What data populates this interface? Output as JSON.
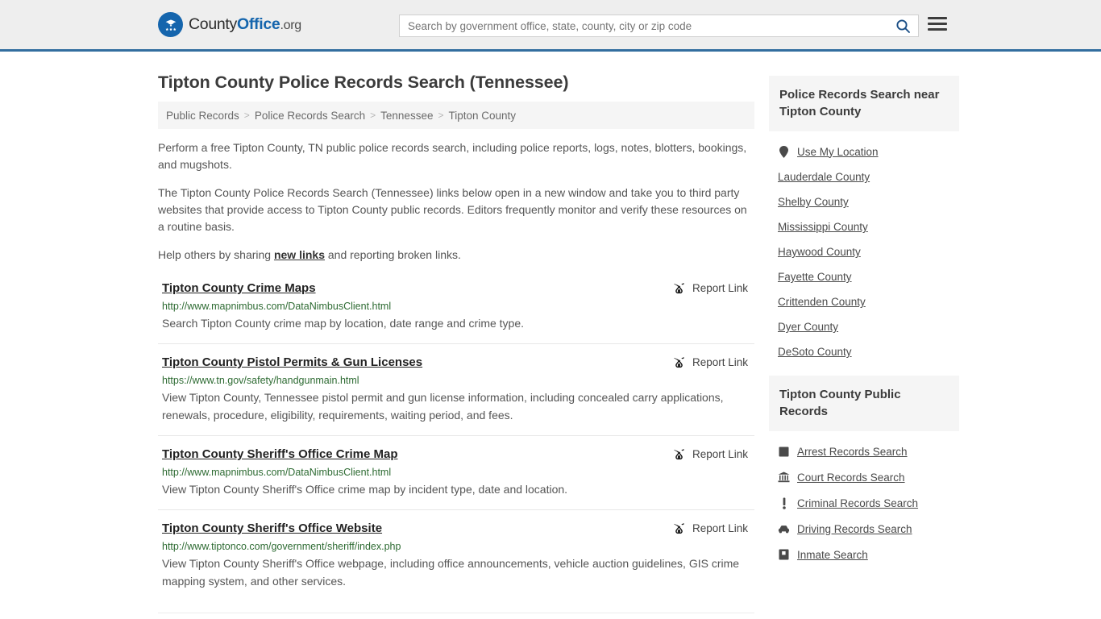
{
  "header": {
    "brand": {
      "part1": "County",
      "part2": "Office",
      "part3": ".org",
      "logo_icon": "eagle-seal-icon"
    },
    "search": {
      "placeholder": "Search by government office, state, county, city or zip code",
      "value": "",
      "icon": "search-icon"
    },
    "menu": {
      "icon": "hamburger-menu-icon",
      "label": "Menu"
    }
  },
  "main": {
    "title": "Tipton County Police Records Search (Tennessee)",
    "breadcrumb": [
      {
        "label": "Public Records"
      },
      {
        "label": "Police Records Search"
      },
      {
        "label": "Tennessee"
      },
      {
        "label": "Tipton County"
      }
    ],
    "breadcrumb_separator": ">",
    "intro": {
      "p1": "Perform a free Tipton County, TN public police records search, including police reports, logs, notes, blotters, bookings, and mugshots.",
      "p2": "The Tipton County Police Records Search (Tennessee) links below open in a new window and take you to third party websites that provide access to Tipton County public records. Editors frequently monitor and verify these resources on a routine basis.",
      "p3_before": "Help others by sharing ",
      "p3_link": "new links",
      "p3_after": " and reporting broken links."
    },
    "report_link_label": "Report Link",
    "report_link_icon": "broken-link-icon",
    "listings": [
      {
        "title": "Tipton County Crime Maps",
        "url": "http://www.mapnimbus.com/DataNimbusClient.html",
        "description": "Search Tipton County crime map by location, date range and crime type."
      },
      {
        "title": "Tipton County Pistol Permits & Gun Licenses",
        "url": "https://www.tn.gov/safety/handgunmain.html",
        "description": "View Tipton County, Tennessee pistol permit and gun license information, including concealed carry applications, renewals, procedure, eligibility, requirements, waiting period, and fees."
      },
      {
        "title": "Tipton County Sheriff's Office Crime Map",
        "url": "http://www.mapnimbus.com/DataNimbusClient.html",
        "description": "View Tipton County Sheriff's Office crime map by incident type, date and location."
      },
      {
        "title": "Tipton County Sheriff's Office Website",
        "url": "http://www.tiptonco.com/government/sheriff/index.php",
        "description": "View Tipton County Sheriff's Office webpage, including office announcements, vehicle auction guidelines, GIS crime mapping system, and other services."
      }
    ]
  },
  "sidebar": {
    "panels": [
      {
        "title": "Police Records Search near Tipton County",
        "items": [
          {
            "label": "Use My Location",
            "icon": "map-pin-icon"
          },
          {
            "label": "Lauderdale County",
            "icon": ""
          },
          {
            "label": "Shelby County",
            "icon": ""
          },
          {
            "label": "Mississippi County",
            "icon": ""
          },
          {
            "label": "Haywood County",
            "icon": ""
          },
          {
            "label": "Fayette County",
            "icon": ""
          },
          {
            "label": "Crittenden County",
            "icon": ""
          },
          {
            "label": "Dyer County",
            "icon": ""
          },
          {
            "label": "DeSoto County",
            "icon": ""
          }
        ]
      },
      {
        "title": "Tipton County Public Records",
        "items": [
          {
            "label": "Arrest Records Search",
            "icon": "fingerprint-icon"
          },
          {
            "label": "Court Records Search",
            "icon": "courthouse-icon"
          },
          {
            "label": "Criminal Records Search",
            "icon": "exclamation-icon"
          },
          {
            "label": "Driving Records Search",
            "icon": "car-icon"
          },
          {
            "label": "Inmate Search",
            "icon": "jail-icon"
          }
        ]
      }
    ]
  },
  "colors": {
    "brand_blue": "#1565ad",
    "header_rule": "#336e9f",
    "url_green": "#2e6b33",
    "panel_bg": "#f5f5f5"
  }
}
